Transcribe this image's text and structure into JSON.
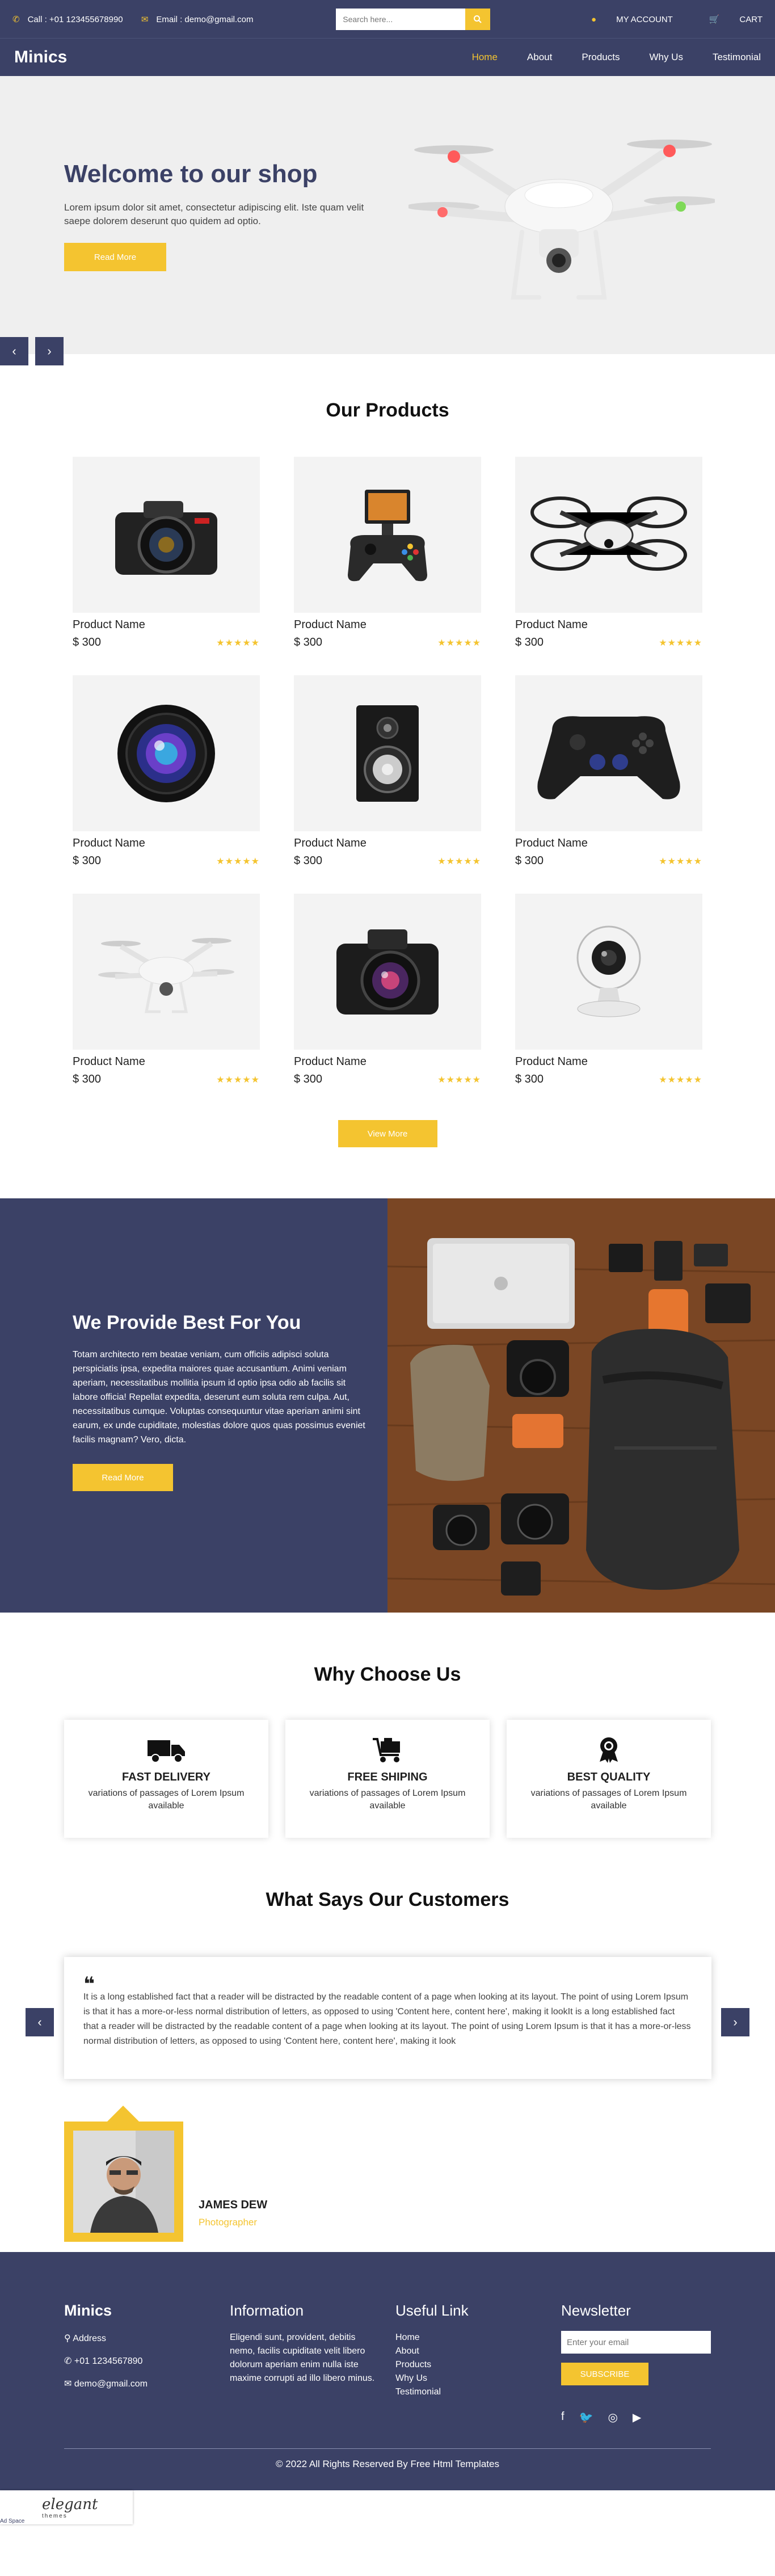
{
  "topbar": {
    "call": "Call : +01 123455678990",
    "email": "Email : demo@gmail.com",
    "search_placeholder": "Search here...",
    "account": "MY ACCOUNT",
    "cart": "CART"
  },
  "nav": {
    "logo": "Minics",
    "items": [
      "Home",
      "About",
      "Products",
      "Why Us",
      "Testimonial"
    ]
  },
  "hero": {
    "title": "Welcome to our shop",
    "text": "Lorem ipsum dolor sit amet, consectetur adipiscing elit. Iste quam velit saepe dolorem deserunt quo quidem ad optio.",
    "button": "Read More",
    "prev": "‹",
    "next": "›"
  },
  "products": {
    "title": "Our Products",
    "items": [
      {
        "name": "Product Name",
        "price": "$ 300",
        "rating": 5,
        "icon": "dslr-camera"
      },
      {
        "name": "Product Name",
        "price": "$ 300",
        "rating": 5,
        "icon": "phone-gamepad"
      },
      {
        "name": "Product Name",
        "price": "$ 300",
        "rating": 5,
        "icon": "mini-drone"
      },
      {
        "name": "Product Name",
        "price": "$ 300",
        "rating": 5,
        "icon": "camera-lens"
      },
      {
        "name": "Product Name",
        "price": "$ 300",
        "rating": 5,
        "icon": "speaker"
      },
      {
        "name": "Product Name",
        "price": "$ 300",
        "rating": 5,
        "icon": "gamepad"
      },
      {
        "name": "Product Name",
        "price": "$ 300",
        "rating": 5,
        "icon": "white-drone"
      },
      {
        "name": "Product Name",
        "price": "$ 300",
        "rating": 5,
        "icon": "black-camera"
      },
      {
        "name": "Product Name",
        "price": "$ 300",
        "rating": 5,
        "icon": "webcam"
      }
    ],
    "view_more": "View More"
  },
  "provide": {
    "title": "We Provide Best For You",
    "text": "Totam architecto rem beatae veniam, cum officiis adipisci soluta perspiciatis ipsa, expedita maiores quae accusantium. Animi veniam aperiam, necessitatibus mollitia ipsum id optio ipsa odio ab facilis sit labore officia! Repellat expedita, deserunt eum soluta rem culpa. Aut, necessitatibus cumque. Voluptas consequuntur vitae aperiam animi sint earum, ex unde cupiditate, molestias dolore quos quas possimus eveniet facilis magnam? Vero, dicta.",
    "button": "Read More"
  },
  "why": {
    "title": "Why Choose Us",
    "features": [
      {
        "title": "FAST DELIVERY",
        "text": "variations of passages of Lorem Ipsum available",
        "icon": "truck-icon"
      },
      {
        "title": "FREE SHIPING",
        "text": "variations of passages of Lorem Ipsum available",
        "icon": "cart-icon"
      },
      {
        "title": "BEST QUALITY",
        "text": "variations of passages of Lorem Ipsum available",
        "icon": "award-icon"
      }
    ]
  },
  "testimonial": {
    "title": "What Says Our Customers",
    "quote_mark": "❝",
    "text": "It is a long established fact that a reader will be distracted by the readable content of a page when looking at its layout. The point of using Lorem Ipsum is that it has a more-or-less normal distribution of letters, as opposed to using 'Content here, content here', making it lookIt is a long established fact that a reader will be distracted by the readable content of a page when looking at its layout. The point of using Lorem Ipsum is that it has a more-or-less normal distribution of letters, as opposed to using 'Content here, content here', making it look",
    "name": "JAMES DEW",
    "role": "Photographer",
    "prev": "‹",
    "next": "›"
  },
  "footer": {
    "logo": "Minics",
    "address": "Address",
    "phone": "+01 1234567890",
    "email": "demo@gmail.com",
    "info_title": "Information",
    "info_text": "Eligendi sunt, provident, debitis nemo, facilis cupiditate velit libero dolorum aperiam enim nulla iste maxime corrupti ad illo libero minus.",
    "links_title": "Useful Link",
    "links": [
      "Home",
      "About",
      "Products",
      "Why Us",
      "Testimonial"
    ],
    "newsletter_title": "Newsletter",
    "newsletter_placeholder": "Enter your email",
    "subscribe": "SUBSCRIBE",
    "copyright": "© 2022 All Rights Reserved By Free Html Templates"
  },
  "badge": {
    "brand": "elegant",
    "sub": "themes",
    "label": "Ad Space"
  },
  "colors": {
    "navy": "#3b4166",
    "accent": "#f4c430"
  }
}
